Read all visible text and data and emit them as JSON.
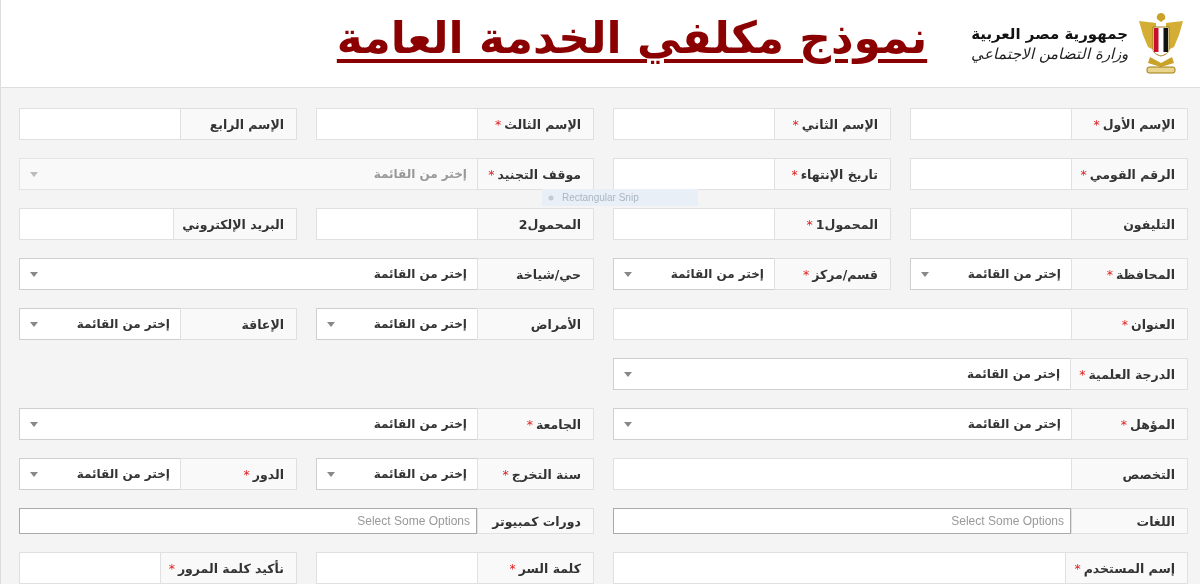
{
  "header": {
    "country": "جمهورية مصر العربية",
    "ministry": "وزارة التضامن الاجتماعي",
    "title": "نموذج مكلفي الخدمة العامة"
  },
  "tooltip": {
    "text": "Rectangular Snip"
  },
  "rows": [
    {
      "groups": [
        [
          {
            "kind": "text",
            "label": "الإسم الأول",
            "mark": "*"
          },
          {
            "kind": "text",
            "label": "الإسم الثاني",
            "mark": "*"
          }
        ],
        [
          {
            "kind": "text",
            "label": "الإسم الثالث",
            "mark": "*"
          },
          {
            "kind": "text",
            "label": "الإسم الرابع"
          }
        ]
      ]
    },
    {
      "groups": [
        [
          {
            "kind": "text",
            "label": "الرقم القومي",
            "mark": "*"
          },
          {
            "kind": "text",
            "label": "تاريخ الإنتهاء",
            "mark": "*"
          }
        ],
        [
          {
            "kind": "select",
            "label": "موقف التجنيد",
            "mark": "*",
            "value": "إختر من القائمة",
            "disabled": true
          }
        ]
      ]
    },
    {
      "groups": [
        [
          {
            "kind": "text",
            "label": "التليفون"
          },
          {
            "kind": "text",
            "label": "المحمول1",
            "mark": "*"
          }
        ],
        [
          {
            "kind": "text",
            "label": "المحمول2"
          },
          {
            "kind": "text",
            "label": "البريد الإلكتروني"
          }
        ]
      ]
    },
    {
      "groups": [
        [
          {
            "kind": "select",
            "label": "المحافظة",
            "mark": "*",
            "value": "إختر من القائمة",
            "disabled": false
          },
          {
            "kind": "select",
            "label": "قسم/مركز",
            "mark": "*",
            "value": "إختر من القائمة",
            "disabled": false
          }
        ],
        [
          {
            "kind": "select",
            "label": "حي/شياخة",
            "value": "إختر من القائمة",
            "disabled": false
          }
        ]
      ]
    },
    {
      "groups": [
        [
          {
            "kind": "text",
            "label": "العنوان",
            "mark": "*"
          }
        ],
        [
          {
            "kind": "select",
            "label": "الأمراض",
            "value": "إختر من القائمة",
            "disabled": false
          },
          {
            "kind": "select",
            "label": "الإعاقة",
            "value": "إختر من القائمة",
            "disabled": false
          }
        ]
      ]
    },
    {
      "groups": [
        [
          {
            "kind": "select",
            "label": "الدرجة العلمية",
            "mark": "*",
            "value": "إختر من القائمة",
            "disabled": false
          }
        ]
      ]
    },
    {
      "groups": [
        [
          {
            "kind": "select",
            "label": "المؤهل",
            "mark": "*",
            "value": "إختر من القائمة",
            "disabled": false
          }
        ],
        [
          {
            "kind": "select",
            "label": "الجامعة",
            "mark": "*",
            "value": "إختر من القائمة",
            "disabled": false
          }
        ]
      ]
    },
    {
      "groups": [
        [
          {
            "kind": "text",
            "label": "التخصص"
          }
        ],
        [
          {
            "kind": "select",
            "label": "سنة التخرج",
            "mark": "*",
            "value": "إختر من القائمة",
            "disabled": false
          },
          {
            "kind": "select",
            "label": "الدور",
            "mark": "*",
            "value": "إختر من القائمة",
            "disabled": false
          }
        ]
      ]
    },
    {
      "groups": [
        [
          {
            "kind": "multi",
            "label": "اللغات",
            "placeholder": "Select Some Options"
          }
        ],
        [
          {
            "kind": "multi",
            "label": "دورات كمبيوتر",
            "placeholder": "Select Some Options"
          }
        ]
      ]
    },
    {
      "groups": [
        [
          {
            "kind": "text",
            "label": "إسم المستخدم",
            "mark": "*"
          }
        ],
        [
          {
            "kind": "text",
            "label": "كلمة السر",
            "mark": "*"
          },
          {
            "kind": "text",
            "label": "نأكيد كلمة المرور",
            "mark": "*"
          }
        ]
      ]
    }
  ]
}
